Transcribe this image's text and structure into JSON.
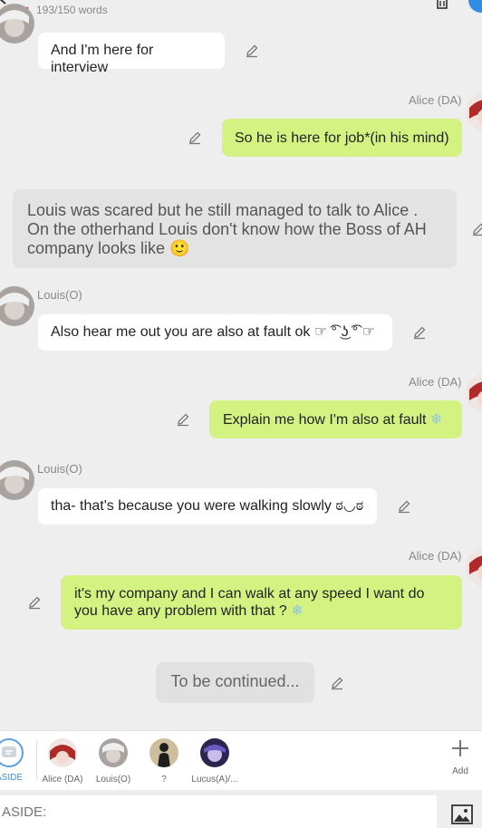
{
  "topbar": {
    "word_count": "193/150 words",
    "icons": [
      "back-icon",
      "pencil-icon",
      "trash-icon"
    ]
  },
  "messages": [
    {
      "side": "left",
      "text": "And I'm here for interview"
    },
    {
      "side": "right",
      "speaker": "Alice (DA)",
      "text": "So he is here for job*(in his mind)"
    },
    {
      "side": "aside",
      "line1": "Louis was scared but he still managed to talk to Alice .",
      "line2": "On the otherhand Louis don't know how the Boss of AH",
      "line3": "company looks like",
      "emoji": "🙂"
    },
    {
      "side": "left",
      "speaker": "Louis(O)",
      "text": "Also hear me out you are also at fault ok ☞  ͡° ͜ʖ ͡° ☞"
    },
    {
      "side": "right",
      "speaker": "Alice (DA)",
      "text": "Explain me how I'm also at fault",
      "emoji": "❄"
    },
    {
      "side": "left",
      "speaker": "Louis(O)",
      "text": "tha- that's because you were walking slowly ಠ◡ಠ"
    },
    {
      "side": "right",
      "speaker": "Alice (DA)",
      "line1": "it's my company and I can walk at any speed I want do",
      "line2": "you have any problem with that ?",
      "emoji": "❄"
    },
    {
      "side": "center",
      "text": "To be continued..."
    }
  ],
  "characters": {
    "aside_label": "ASIDE",
    "list": [
      {
        "label": "Alice (DA)"
      },
      {
        "label": "Louis(O)"
      },
      {
        "label": "?"
      },
      {
        "label": "Lucus(A)/..."
      }
    ],
    "add_label": "Add"
  },
  "input": {
    "placeholder": "ASIDE:"
  },
  "colors": {
    "user_bubble": "#d4f282",
    "other_bubble": "#ffffff",
    "aside_bubble": "#e3e3e3",
    "accent": "#2f8de4"
  }
}
